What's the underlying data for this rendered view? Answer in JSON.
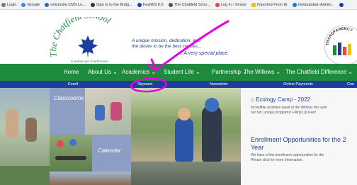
{
  "bookmarks": [
    {
      "label": "Login",
      "color": "#777777"
    },
    {
      "label": "Google",
      "color": "#4285f4"
    },
    {
      "label": "netsmsite CMS Lo...",
      "color": "#2a6ebb"
    },
    {
      "label": "Sign in to the Bridg...",
      "color": "#333333"
    },
    {
      "label": "FastWS 6.0",
      "color": "#1b3f9c"
    },
    {
      "label": "The Chatfield Scho...",
      "color": "#555555"
    },
    {
      "label": "Log in ‹ Smore",
      "color": "#e8453c"
    },
    {
      "label": "Imported From IE",
      "color": "#f2c200"
    },
    {
      "label": "GoGuardian Admin...",
      "color": "#1a73e8"
    }
  ],
  "header": {
    "logo_text": "The Chatfield School",
    "logo_motto": "Gaudium per Eruditionem",
    "tagline_1": "A unique mission, dedication, and",
    "tagline_2": "the desire to be the best creates...",
    "tagline_3": "..... A very special place.",
    "badge_text": "TRANSPARENCY"
  },
  "nav": [
    {
      "label": "Home"
    },
    {
      "label": "About Us"
    },
    {
      "label": "Academics"
    },
    {
      "label": "Student Life"
    },
    {
      "label": "Partnership"
    },
    {
      "label": "The Willows"
    },
    {
      "label": "The Chatfield Difference"
    }
  ],
  "subnav": [
    {
      "label": "Enroll"
    },
    {
      "label": "Skyward"
    },
    {
      "label": "Newsletter"
    },
    {
      "label": "Online Payments"
    },
    {
      "label": "Con"
    }
  ],
  "tiles": {
    "classrooms": "Classrooms",
    "calendar": "Calendar"
  },
  "news": [
    {
      "title": "Ecology Camp - 2022",
      "line1": "Incredible activities await at the Willows this sum",
      "line2": "our fun, unique programs! Filling Up Fast!"
    },
    {
      "title_a": "Enrollment Opportunities for the 2",
      "title_b": "Year",
      "line1": "We have a few enrollment opportunities for the",
      "line2": "Please click for more information."
    }
  ],
  "colors": {
    "nav_green": "#1e8a3c",
    "subnav_blue": "#1b3f9c",
    "annotation_magenta": "#e600e6"
  }
}
